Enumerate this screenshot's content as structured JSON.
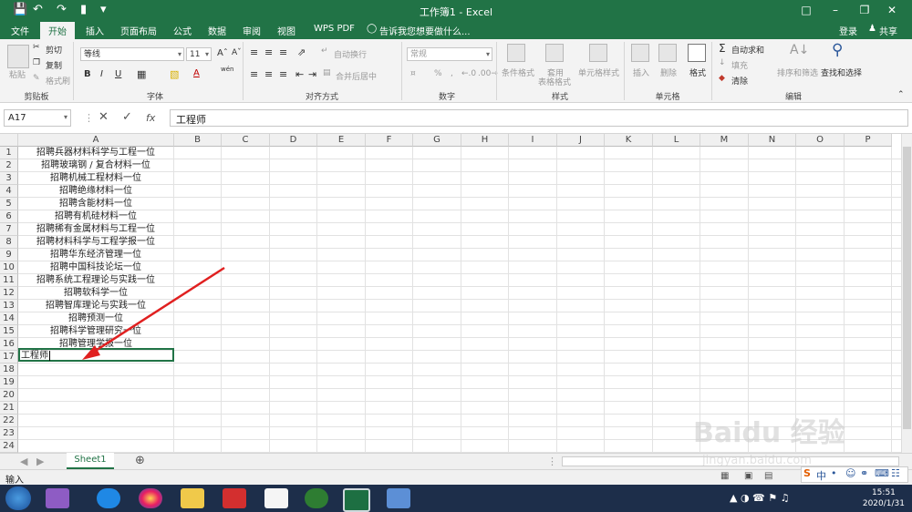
{
  "window": {
    "title": "工作簿1 - Excel"
  },
  "ribbon_tabs": [
    "文件",
    "开始",
    "插入",
    "页面布局",
    "公式",
    "数据",
    "审阅",
    "视图",
    "WPS PDF"
  ],
  "tell_me": "告诉我您想要做什么...",
  "account": {
    "signin": "登录",
    "share": "共享"
  },
  "clipboard": {
    "paste": "粘贴",
    "cut": "剪切",
    "copy": "复制",
    "format_painter": "格式刷",
    "group": "剪贴板"
  },
  "font": {
    "name": "等线",
    "size": "11",
    "bold": "B",
    "italic": "I",
    "underline": "U",
    "color_a": "A",
    "wen": "wén",
    "group": "字体"
  },
  "alignment": {
    "wrap": "自动换行",
    "merge": "合并后居中",
    "group": "对齐方式"
  },
  "number": {
    "format": "常规",
    "percent": "%",
    "comma": ",",
    "group": "数字"
  },
  "styles": {
    "conditional": "条件格式",
    "table_format_line1": "套用",
    "table_format_line2": "表格格式",
    "cell_styles": "单元格样式",
    "group": "样式"
  },
  "cells": {
    "insert": "插入",
    "delete": "删除",
    "format": "格式",
    "group": "单元格"
  },
  "editing": {
    "autosum": "自动求和",
    "fill": "填充",
    "clear": "清除",
    "sort_filter": "排序和筛选",
    "find_select": "查找和选择",
    "group": "编辑"
  },
  "formula_bar": {
    "name_box": "A17",
    "content": "工程师",
    "fx": "fx"
  },
  "columns": [
    "A",
    "B",
    "C",
    "D",
    "E",
    "F",
    "G",
    "H",
    "I",
    "J",
    "K",
    "L",
    "M",
    "N",
    "O",
    "P"
  ],
  "rows": [
    "1",
    "2",
    "3",
    "4",
    "5",
    "6",
    "7",
    "8",
    "9",
    "10",
    "11",
    "12",
    "13",
    "14",
    "15",
    "16",
    "17",
    "18",
    "19",
    "20",
    "21",
    "22",
    "23",
    "24"
  ],
  "cells_a": [
    "招聘兵器材料科学与工程一位",
    "招聘玻璃钢 / 复合材料一位",
    "招聘机械工程材料一位",
    "招聘绝缘材料一位",
    "招聘含能材料一位",
    "招聘有机硅材料一位",
    "招聘稀有金属材料与工程一位",
    "招聘材料科学与工程学报一位",
    "招聘华东经济管理一位",
    "招聘中国科技论坛一位",
    "招聘系统工程理论与实践一位",
    "招聘软科学一位",
    "招聘智库理论与实践一位",
    "招聘预测一位",
    "招聘科学管理研究一位",
    "招聘管理学报一位"
  ],
  "editing_cell": "工程师",
  "sheet_tab": "Sheet1",
  "status": {
    "mode": "输入"
  },
  "clock": {
    "time": "15:51",
    "date": "2020/1/31"
  },
  "ime": {
    "lang": "中"
  },
  "watermark": "Baidu 经验",
  "watermark_sub": "jingyan.baidu.com"
}
